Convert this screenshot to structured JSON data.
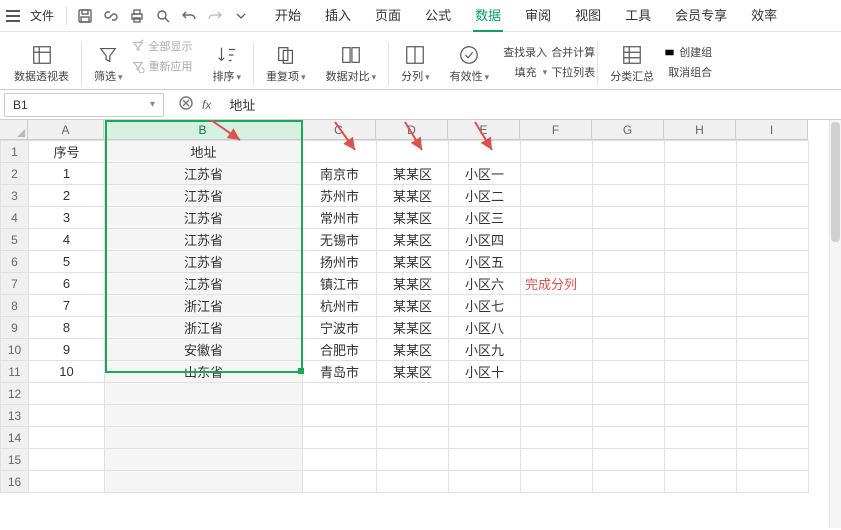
{
  "menu": {
    "file": "文件",
    "tabs": [
      "开始",
      "插入",
      "页面",
      "公式",
      "数据",
      "审阅",
      "视图",
      "工具",
      "会员专享",
      "效率"
    ],
    "active": 4
  },
  "ribbon": {
    "pivot": "数据透视表",
    "filter": "筛选",
    "showall": "全部显示",
    "reapply": "重新应用",
    "sort": "排序",
    "dup": "重复项",
    "datacmp": "数据对比",
    "split": "分列",
    "validity": "有效性",
    "findentry": "查找录入",
    "consolidate": "合并计算",
    "fill": "填充",
    "dropdown": "下拉列表",
    "subtotal": "分类汇总",
    "group": "创建组",
    "ungroup": "取消组合"
  },
  "fbar": {
    "name": "B1",
    "value": "地址"
  },
  "cols": [
    "A",
    "B",
    "C",
    "D",
    "E",
    "F",
    "G",
    "H",
    "I"
  ],
  "rows": [
    {
      "n": "1",
      "A": "序号",
      "B": "地址",
      "C": "",
      "D": "",
      "E": "",
      "F": ""
    },
    {
      "n": "2",
      "A": "1",
      "B": "江苏省",
      "C": "南京市",
      "D": "某某区",
      "E": "小区一",
      "F": ""
    },
    {
      "n": "3",
      "A": "2",
      "B": "江苏省",
      "C": "苏州市",
      "D": "某某区",
      "E": "小区二",
      "F": ""
    },
    {
      "n": "4",
      "A": "3",
      "B": "江苏省",
      "C": "常州市",
      "D": "某某区",
      "E": "小区三",
      "F": ""
    },
    {
      "n": "5",
      "A": "4",
      "B": "江苏省",
      "C": "无锡市",
      "D": "某某区",
      "E": "小区四",
      "F": ""
    },
    {
      "n": "6",
      "A": "5",
      "B": "江苏省",
      "C": "扬州市",
      "D": "某某区",
      "E": "小区五",
      "F": ""
    },
    {
      "n": "7",
      "A": "6",
      "B": "江苏省",
      "C": "镇江市",
      "D": "某某区",
      "E": "小区六",
      "F": "完成分列"
    },
    {
      "n": "8",
      "A": "7",
      "B": "浙江省",
      "C": "杭州市",
      "D": "某某区",
      "E": "小区七",
      "F": ""
    },
    {
      "n": "9",
      "A": "8",
      "B": "浙江省",
      "C": "宁波市",
      "D": "某某区",
      "E": "小区八",
      "F": ""
    },
    {
      "n": "10",
      "A": "9",
      "B": "安徽省",
      "C": "合肥市",
      "D": "某某区",
      "E": "小区九",
      "F": ""
    },
    {
      "n": "11",
      "A": "10",
      "B": "山东省",
      "C": "青岛市",
      "D": "某某区",
      "E": "小区十",
      "F": ""
    },
    {
      "n": "12",
      "A": "",
      "B": "",
      "C": "",
      "D": "",
      "E": "",
      "F": ""
    },
    {
      "n": "13",
      "A": "",
      "B": "",
      "C": "",
      "D": "",
      "E": "",
      "F": ""
    },
    {
      "n": "14",
      "A": "",
      "B": "",
      "C": "",
      "D": "",
      "E": "",
      "F": ""
    },
    {
      "n": "15",
      "A": "",
      "B": "",
      "C": "",
      "D": "",
      "E": "",
      "F": ""
    },
    {
      "n": "16",
      "A": "",
      "B": "",
      "C": "",
      "D": "",
      "E": "",
      "F": ""
    }
  ],
  "annotation": "完成分列"
}
